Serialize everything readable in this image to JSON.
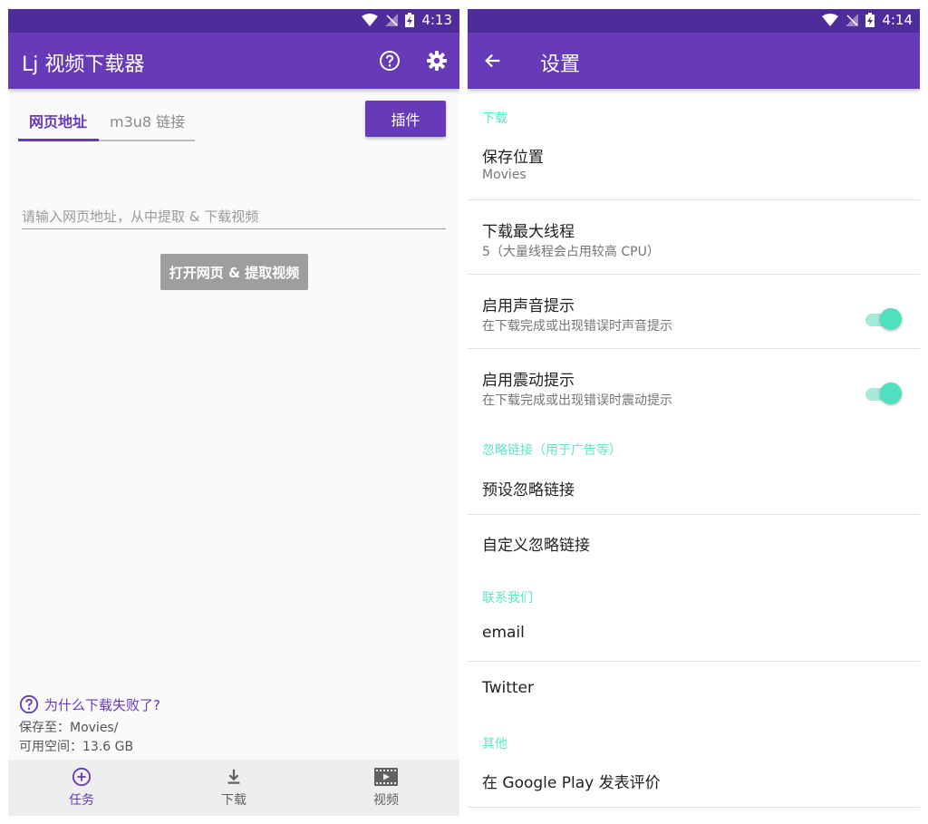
{
  "colors": {
    "primary": "#673ab7",
    "primary_dark": "#4e2c9c",
    "accent": "#5fe6c9",
    "button_disabled": "#9e9e9e"
  },
  "left": {
    "statusbar": {
      "time": "4:13"
    },
    "appbar": {
      "title": "Lj 视频下载器",
      "help_icon": "help-circle-icon",
      "settings_icon": "gear-icon"
    },
    "tabs": [
      {
        "label": "网页地址",
        "active": true
      },
      {
        "label": "m3u8 链接",
        "active": false
      }
    ],
    "plugin_button": "插件",
    "url_input": {
      "placeholder": "请输入网页地址，从中提取 & 下载视频",
      "value": ""
    },
    "open_button": "打开网页 & 提取视频",
    "help_link": "为什么下载失败了?",
    "save_to": "保存至：Movies/",
    "free_space": "可用空间：13.6 GB",
    "bottom_nav": [
      {
        "label": "任务",
        "icon": "add-circle-icon",
        "active": true
      },
      {
        "label": "下载",
        "icon": "download-icon",
        "active": false
      },
      {
        "label": "视频",
        "icon": "film-icon",
        "active": false
      }
    ]
  },
  "right": {
    "statusbar": {
      "time": "4:14"
    },
    "appbar": {
      "title": "设置",
      "back_icon": "arrow-back-icon"
    },
    "sections": {
      "download": "下载",
      "ignore": "忽略链接（用于广告等）",
      "contact": "联系我们",
      "other": "其他"
    },
    "prefs": {
      "save_location": {
        "title": "保存位置",
        "summary": "Movies"
      },
      "max_threads": {
        "title": "下载最大线程",
        "summary": "5（大量线程会占用较高 CPU）"
      },
      "sound": {
        "title": "启用声音提示",
        "summary": "在下载完成或出现错误时声音提示",
        "enabled": true
      },
      "vibrate": {
        "title": "启用震动提示",
        "summary": "在下载完成或出现错误时震动提示",
        "enabled": true
      },
      "preset_ignore": {
        "title": "预设忽略链接"
      },
      "custom_ignore": {
        "title": "自定义忽略链接"
      },
      "email": {
        "title": "email"
      },
      "twitter": {
        "title": "Twitter"
      },
      "rate": {
        "title": "在 Google Play 发表评价"
      }
    }
  }
}
